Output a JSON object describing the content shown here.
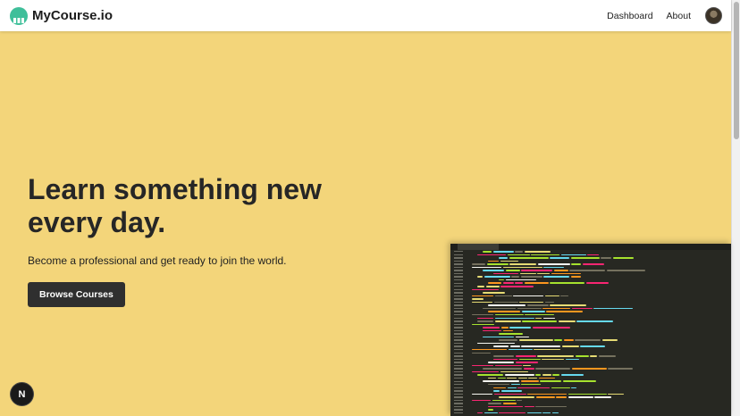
{
  "app": {
    "brand": "MyCourse.io"
  },
  "nav": {
    "links": [
      "Dashboard",
      "About"
    ]
  },
  "hero": {
    "title": "Learn something new every day.",
    "subtitle": "Become a professional and get ready to join the world.",
    "cta_label": "Browse Courses"
  },
  "badge": {
    "letter": "N"
  },
  "colors": {
    "hero_bg": "#f3d57a",
    "button": "#2f2f2f",
    "brand_icon": "#3fbf9a",
    "editor_bg": "#272822"
  },
  "icons": {
    "brand": "course-logo-icon",
    "avatar": "user-avatar"
  }
}
